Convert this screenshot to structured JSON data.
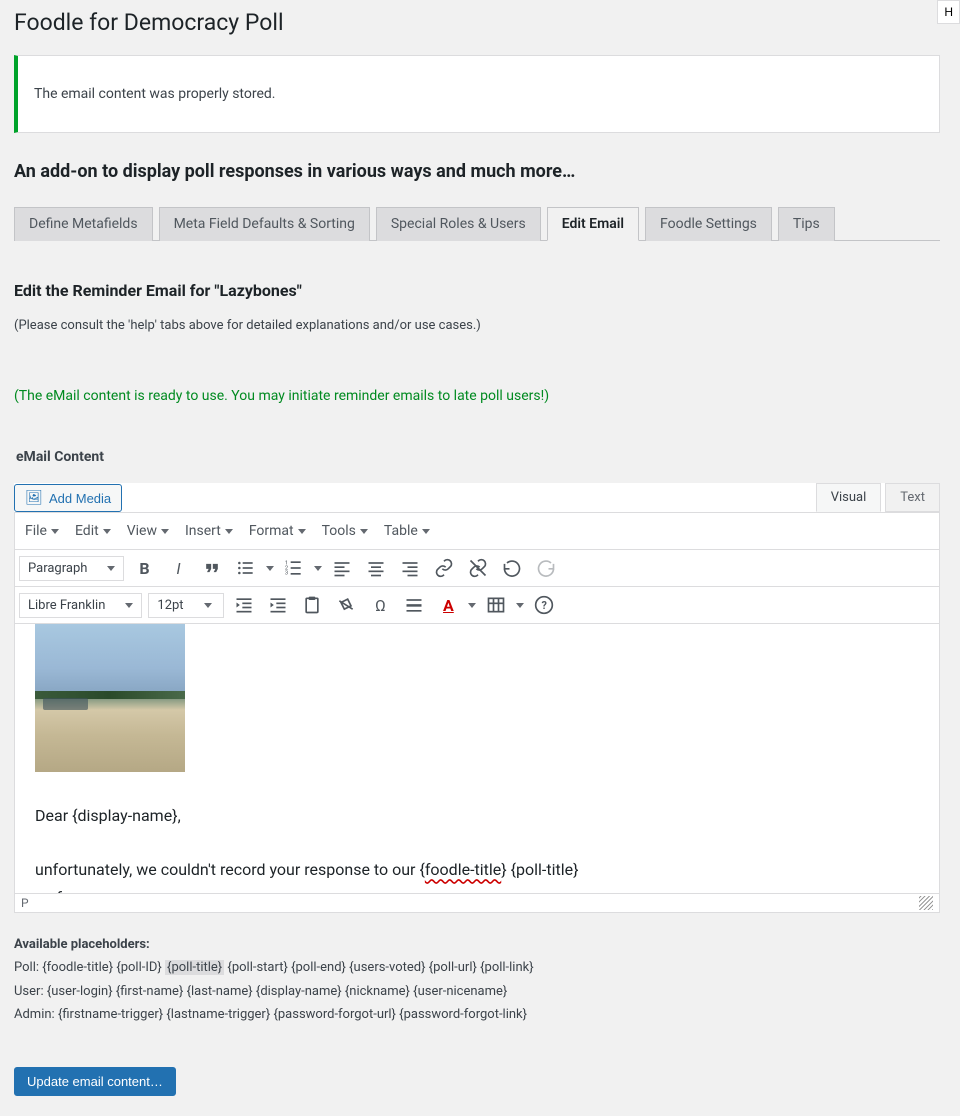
{
  "page": {
    "title": "Foodle for Democracy Poll",
    "header_btn": "H"
  },
  "notice": {
    "message": "The email content was properly stored."
  },
  "subtitle": "An add-on to display poll responses in various ways and much more…",
  "tabs": {
    "define_metafields": "Define Metafields",
    "meta_field_defaults": "Meta Field Defaults & Sorting",
    "special_roles": "Special Roles & Users",
    "edit_email": "Edit Email",
    "foodle_settings": "Foodle Settings",
    "tips": "Tips"
  },
  "section": {
    "title": "Edit the Reminder Email for \"Lazybones\"",
    "help": "(Please consult the 'help' tabs above for detailed explanations and/or use cases.)",
    "ready": "(The eMail content is ready to use. You may initiate reminder emails to late poll users!)"
  },
  "editor": {
    "content_label": "eMail Content",
    "add_media": "Add Media",
    "tab_visual": "Visual",
    "tab_text": "Text",
    "menus": {
      "file": "File",
      "edit": "Edit",
      "view": "View",
      "insert": "Insert",
      "format": "Format",
      "tools": "Tools",
      "table": "Table"
    },
    "format_select": "Paragraph",
    "font_select": "Libre Franklin",
    "fontsize_select": "12pt",
    "status_path": "P",
    "body": {
      "greeting": "Dear {display-name},",
      "line1_a": "unfortunately, we couldn't record your response to our {",
      "line1_spell": "foodle-title",
      "line1_b": "} {poll-title}",
      "line2": "so far"
    }
  },
  "placeholders": {
    "heading": "Available placeholders:",
    "poll_label": "Poll:",
    "poll_items": "  {foodle-title}  {poll-ID}  ",
    "poll_highlight": "{poll-title}",
    "poll_items2": "  {poll-start}  {poll-end}  {users-voted}  {poll-url}  {poll-link}",
    "user_label": "User:",
    "user_items": "  {user-login}  {first-name}  {last-name}  {display-name}  {nickname}  {user-nicename}",
    "admin_label": "Admin:",
    "admin_items": "  {firstname-trigger}  {lastname-trigger}  {password-forgot-url}  {password-forgot-link}"
  },
  "update_btn": "Update email content…"
}
